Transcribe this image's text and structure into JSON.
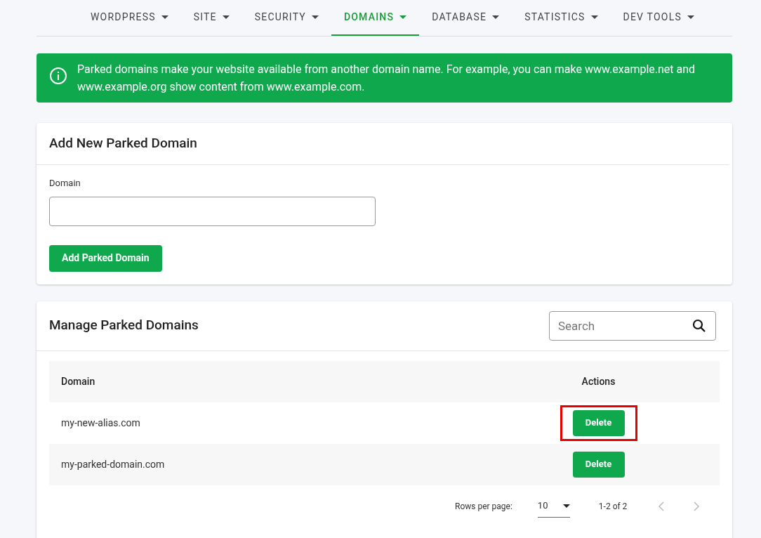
{
  "nav": [
    {
      "label": "WORDPRESS",
      "selected": false
    },
    {
      "label": "SITE",
      "selected": false
    },
    {
      "label": "SECURITY",
      "selected": false
    },
    {
      "label": "DOMAINS",
      "selected": true
    },
    {
      "label": "DATABASE",
      "selected": false
    },
    {
      "label": "STATISTICS",
      "selected": false
    },
    {
      "label": "DEV TOOLS",
      "selected": false
    }
  ],
  "info": "Parked domains make your website available from another domain name. For example, you can make www.example.net and www.example.org show content from www.example.com.",
  "add_card": {
    "title": "Add New Parked Domain",
    "field_label": "Domain",
    "button": "Add Parked Domain"
  },
  "manage_card": {
    "title": "Manage Parked Domains",
    "search": {
      "placeholder": "Search"
    },
    "table": {
      "columns": [
        "Domain",
        "Actions"
      ],
      "rows": [
        {
          "domain": "my-new-alias.com",
          "action": "Delete",
          "highlighted": true
        },
        {
          "domain": "my-parked-domain.com",
          "action": "Delete",
          "highlighted": false
        }
      ]
    },
    "pagination": {
      "label": "Rows per page:",
      "rows_per_page": "10",
      "range": "1-2 of 2"
    }
  }
}
